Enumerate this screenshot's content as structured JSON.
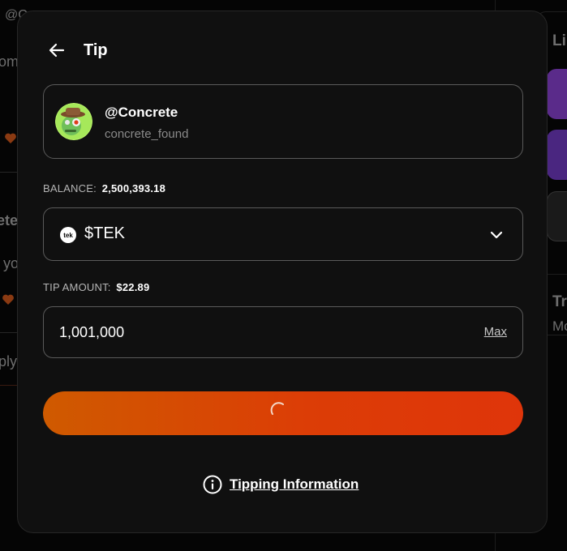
{
  "background": {
    "left_fragments": [
      "@C",
      "om",
      "ete",
      "yo",
      "ply"
    ],
    "right_fragments": [
      "Li",
      "Tr",
      "Mc"
    ]
  },
  "modal": {
    "title": "Tip",
    "recipient": {
      "handle": "@Concrete",
      "username": "concrete_found"
    },
    "balance": {
      "label": "BALANCE:",
      "value": "2,500,393.18"
    },
    "token": {
      "symbol": "$TEK",
      "logo_text": "tek"
    },
    "tip_amount": {
      "label": "TIP AMOUNT:",
      "usd_value": "$22.89",
      "input_value": "1,001,000",
      "max_label": "Max"
    },
    "submit": {
      "state": "loading"
    },
    "info_link": "Tipping Information"
  },
  "colors": {
    "modal_bg": "#101010",
    "border": "#5a5a5a",
    "accent_start": "#cf5a00",
    "accent_end": "#df350a"
  }
}
